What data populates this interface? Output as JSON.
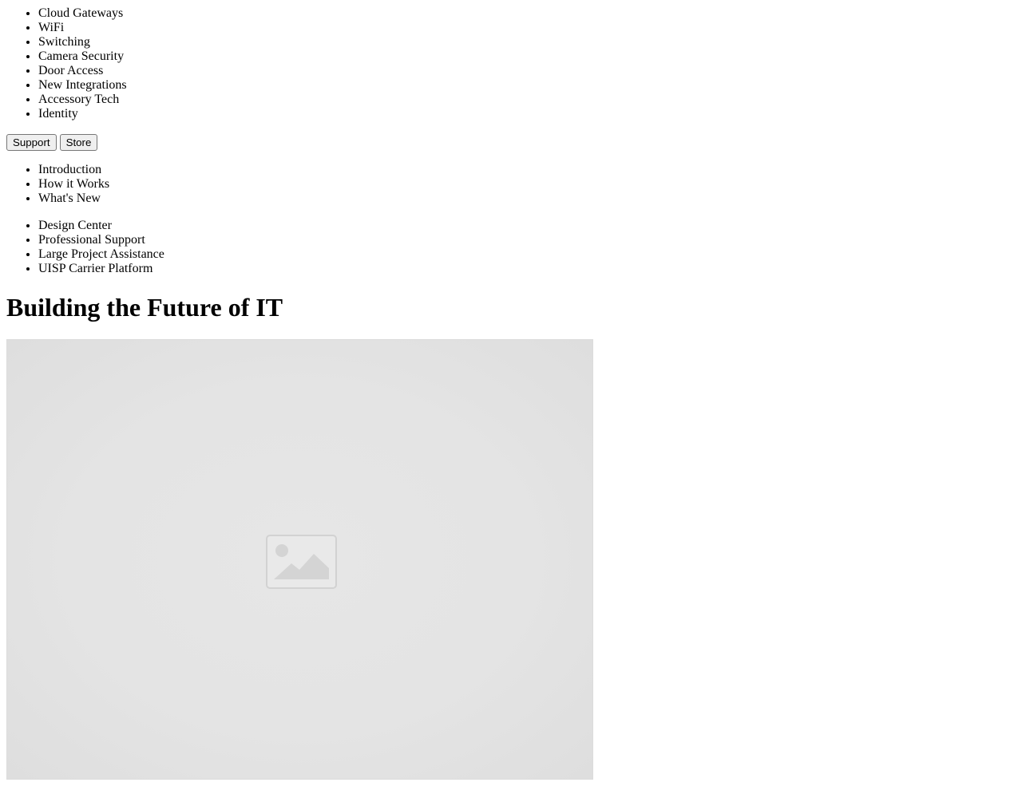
{
  "product_nav": {
    "items": [
      "Cloud Gateways",
      "WiFi",
      "Switching",
      "Camera Security",
      "Door Access",
      "New Integrations",
      "Accessory Tech",
      "Identity"
    ]
  },
  "header_buttons": {
    "support_label": "Support",
    "store_label": "Store"
  },
  "intro_nav": {
    "items": [
      "Introduction",
      "How it Works",
      "What's New"
    ]
  },
  "services_nav": {
    "items": [
      "Design Center",
      "Professional Support",
      "Large Project Assistance",
      "UISP Carrier Platform"
    ]
  },
  "hero": {
    "title": "Building the Future of IT",
    "media_icon": "image-placeholder-icon"
  }
}
